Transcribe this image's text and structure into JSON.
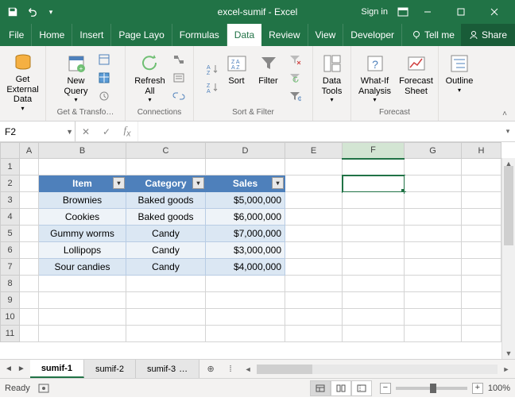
{
  "titlebar": {
    "title": "excel-sumif - Excel",
    "signin": "Sign in"
  },
  "tabs": {
    "file": "File",
    "home": "Home",
    "insert": "Insert",
    "pagelayout": "Page Layo",
    "formulas": "Formulas",
    "data": "Data",
    "review": "Review",
    "view": "View",
    "developer": "Developer",
    "tellme": "Tell me",
    "share": "Share"
  },
  "ribbon": {
    "get_external": "Get External Data",
    "new_query": "New Query",
    "group_get_transform": "Get & Transfo…",
    "refresh_all": "Refresh All",
    "group_connections": "Connections",
    "sort": "Sort",
    "filter": "Filter",
    "group_sort_filter": "Sort & Filter",
    "data_tools": "Data Tools",
    "whatif": "What-If Analysis",
    "forecast_sheet": "Forecast Sheet",
    "group_forecast": "Forecast",
    "outline": "Outline"
  },
  "namebox": {
    "value": "F2"
  },
  "columns": [
    "A",
    "B",
    "C",
    "D",
    "E",
    "F",
    "G",
    "H"
  ],
  "rows": [
    "1",
    "2",
    "3",
    "4",
    "5",
    "6",
    "7",
    "8",
    "9",
    "10",
    "11"
  ],
  "table": {
    "headers": [
      "Item",
      "Category",
      "Sales"
    ],
    "rows": [
      [
        "Brownies",
        "Baked goods",
        "$5,000,000"
      ],
      [
        "Cookies",
        "Baked goods",
        "$6,000,000"
      ],
      [
        "Gummy worms",
        "Candy",
        "$7,000,000"
      ],
      [
        "Lollipops",
        "Candy",
        "$3,000,000"
      ],
      [
        "Sour candies",
        "Candy",
        "$4,000,000"
      ]
    ]
  },
  "sheets": {
    "active": "sumif-1",
    "others": [
      "sumif-2",
      "sumif-3"
    ]
  },
  "statusbar": {
    "ready": "Ready",
    "zoom": "100%"
  }
}
